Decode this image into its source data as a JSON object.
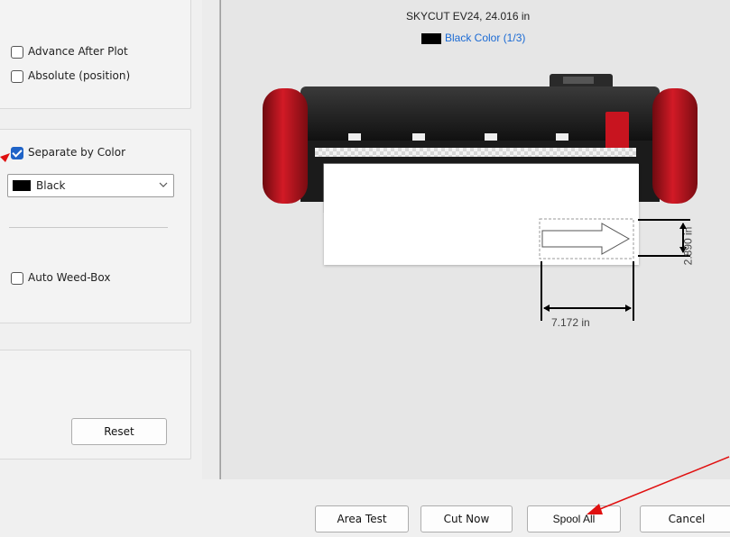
{
  "options": {
    "advance_after_plot": {
      "label": "Advance After Plot",
      "checked": false
    },
    "absolute_position": {
      "label": "Absolute (position)",
      "checked": false
    },
    "separate_by_color": {
      "label": "Separate by Color",
      "checked": true
    },
    "color_select": {
      "value": "Black",
      "swatch": "#000000"
    },
    "auto_weed_box": {
      "label": "Auto Weed-Box",
      "checked": false
    },
    "reset_label": "Reset"
  },
  "preview": {
    "machine_title": "SKYCUT EV24,  24.016 in",
    "color_link": "Black Color (1/3)",
    "color_swatch": "#000000",
    "width_dimension": "7.172 in",
    "height_dimension": "2.890 in"
  },
  "footer": {
    "area_test": "Area Test",
    "cut_now": "Cut Now",
    "spool_all": "Spool All",
    "cancel": "Cancel"
  },
  "colors": {
    "accent": "#1f63c7",
    "annotation_arrow": "#e01010",
    "cutter_red": "#c0121f"
  }
}
